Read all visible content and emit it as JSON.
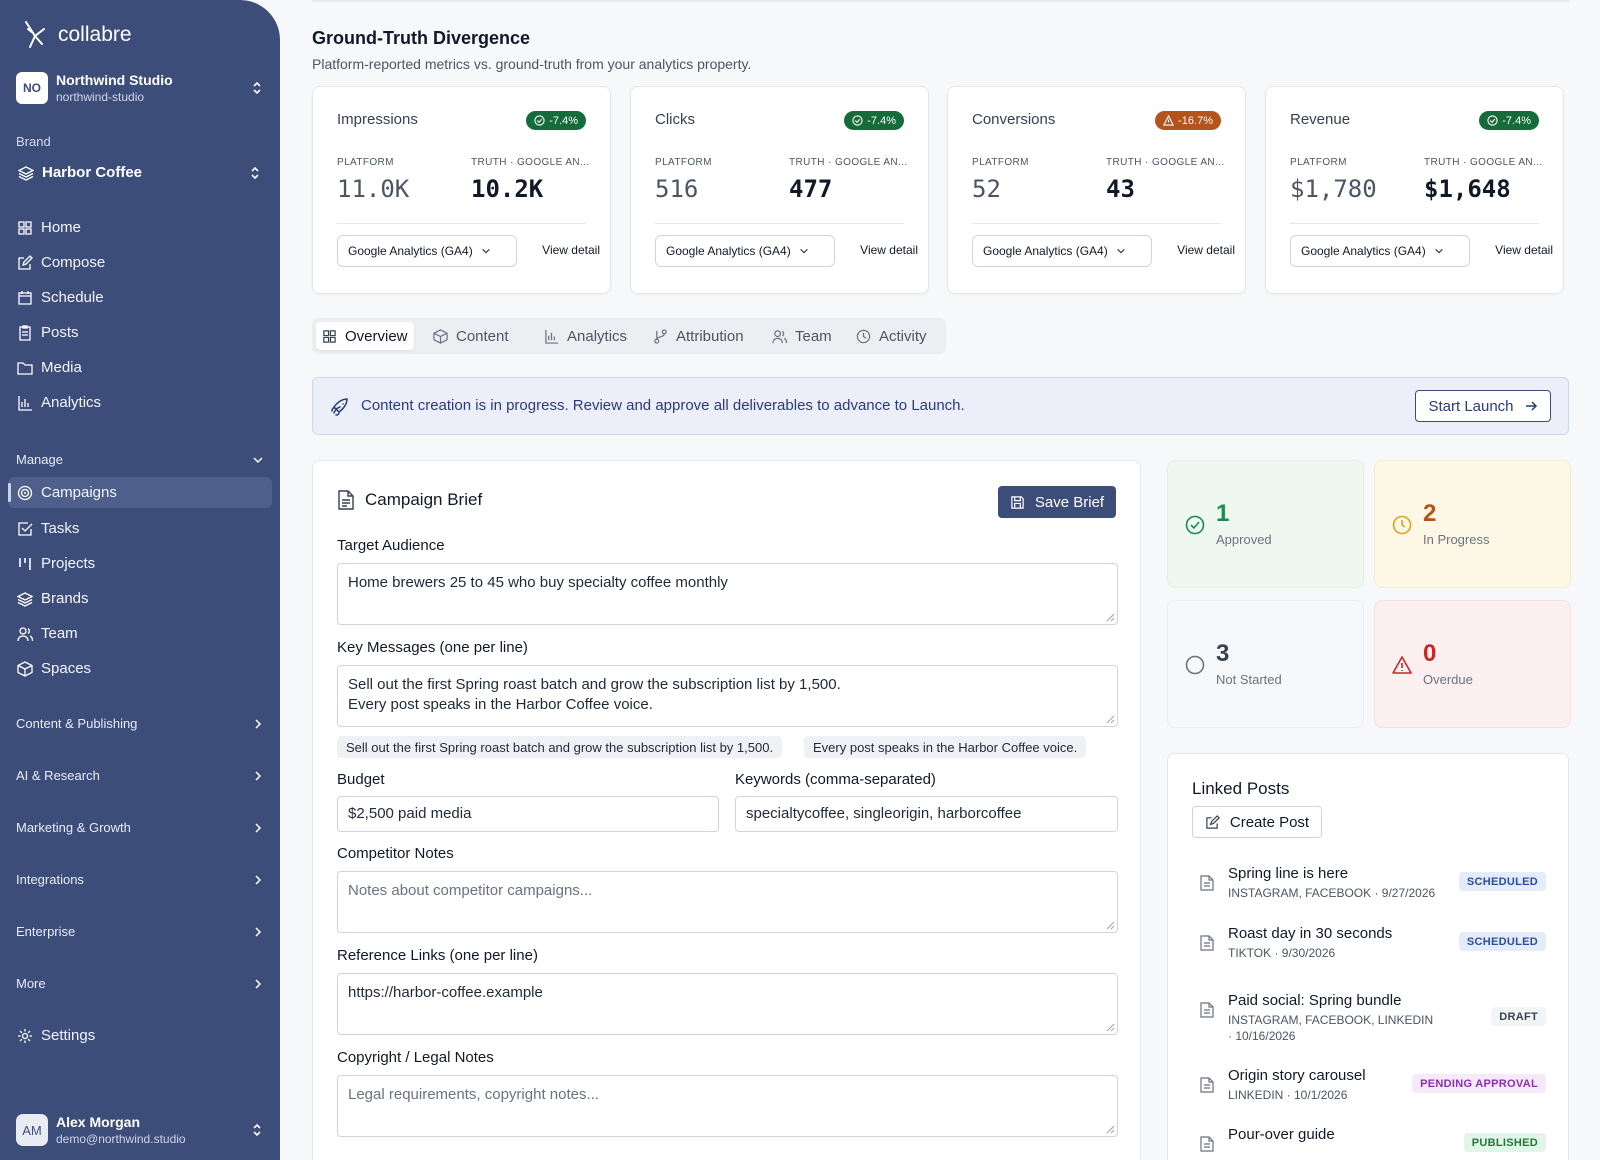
{
  "app": {
    "name": "collabre"
  },
  "org": {
    "badge": "NO",
    "name": "Northwind Studio",
    "slug": "northwind-studio"
  },
  "brand": {
    "label": "Brand",
    "name": "Harbor Coffee"
  },
  "nav": {
    "main": [
      "Home",
      "Compose",
      "Schedule",
      "Posts",
      "Media",
      "Analytics"
    ],
    "manage_label": "Manage",
    "manage": [
      "Campaigns",
      "Tasks",
      "Projects",
      "Brands",
      "Team",
      "Spaces"
    ],
    "active": "Campaigns",
    "groups": [
      "Content & Publishing",
      "AI & Research",
      "Marketing & Growth",
      "Integrations",
      "Enterprise",
      "More"
    ],
    "settings": "Settings"
  },
  "user": {
    "initials": "AM",
    "name": "Alex Morgan",
    "email": "demo@northwind.studio"
  },
  "divergence": {
    "title": "Ground-Truth Divergence",
    "subtitle": "Platform-reported metrics vs. ground-truth from your analytics property.",
    "platform_label": "PLATFORM",
    "truth_label": "TRUTH · GOOGLE AN...",
    "source": "Google Analytics (GA4)",
    "link": "View detail",
    "cards": [
      {
        "title": "Impressions",
        "delta": "-7.4%",
        "status": "ok",
        "platform": "11.0K",
        "truth": "10.2K"
      },
      {
        "title": "Clicks",
        "delta": "-7.4%",
        "status": "ok",
        "platform": "516",
        "truth": "477"
      },
      {
        "title": "Conversions",
        "delta": "-16.7%",
        "status": "warn",
        "platform": "52",
        "truth": "43"
      },
      {
        "title": "Revenue",
        "delta": "-7.4%",
        "status": "ok",
        "platform": "$1,780",
        "truth": "$1,648"
      }
    ]
  },
  "tabs": [
    "Overview",
    "Content",
    "Analytics",
    "Attribution",
    "Team",
    "Activity"
  ],
  "active_tab": "Overview",
  "banner": {
    "text": "Content creation is in progress. Review and approve all deliverables to advance to Launch.",
    "button": "Start Launch"
  },
  "brief": {
    "title": "Campaign Brief",
    "save": "Save Brief",
    "audience_label": "Target Audience",
    "audience": "Home brewers 25 to 45 who buy specialty coffee monthly",
    "messages_label": "Key Messages (one per line)",
    "messages": [
      "Sell out the first Spring roast batch and grow the subscription list by 1,500.",
      "Every post speaks in the Harbor Coffee voice."
    ],
    "budget_label": "Budget",
    "budget": "$2,500 paid media",
    "keywords_label": "Keywords (comma-separated)",
    "keywords": "specialtycoffee, singleorigin, harborcoffee",
    "competitor_label": "Competitor Notes",
    "competitor_placeholder": "Notes about competitor campaigns...",
    "links_label": "Reference Links (one per line)",
    "links": "https://harbor-coffee.example",
    "legal_label": "Copyright / Legal Notes",
    "legal_placeholder": "Legal requirements, copyright notes..."
  },
  "stats": [
    {
      "value": "1",
      "label": "Approved",
      "color": "#1f8a4c"
    },
    {
      "value": "2",
      "label": "In Progress",
      "color": "#b4531a"
    },
    {
      "value": "3",
      "label": "Not Started",
      "color": "#374151"
    },
    {
      "value": "0",
      "label": "Overdue",
      "color": "#c62828"
    }
  ],
  "linked": {
    "title": "Linked Posts",
    "create": "Create Post",
    "posts": [
      {
        "title": "Spring line is here",
        "meta": "INSTAGRAM, FACEBOOK · 9/27/2026",
        "status": "SCHEDULED"
      },
      {
        "title": "Roast day in 30 seconds",
        "meta": "TIKTOK · 9/30/2026",
        "status": "SCHEDULED"
      },
      {
        "title": "Paid social: Spring bundle",
        "meta": "INSTAGRAM, FACEBOOK, LINKEDIN · 10/16/2026",
        "status": "DRAFT"
      },
      {
        "title": "Origin story carousel",
        "meta": "LINKEDIN · 10/1/2026",
        "status": "PENDING APPROVAL"
      },
      {
        "title": "Pour-over guide",
        "meta": "",
        "status": "PUBLISHED"
      }
    ]
  }
}
